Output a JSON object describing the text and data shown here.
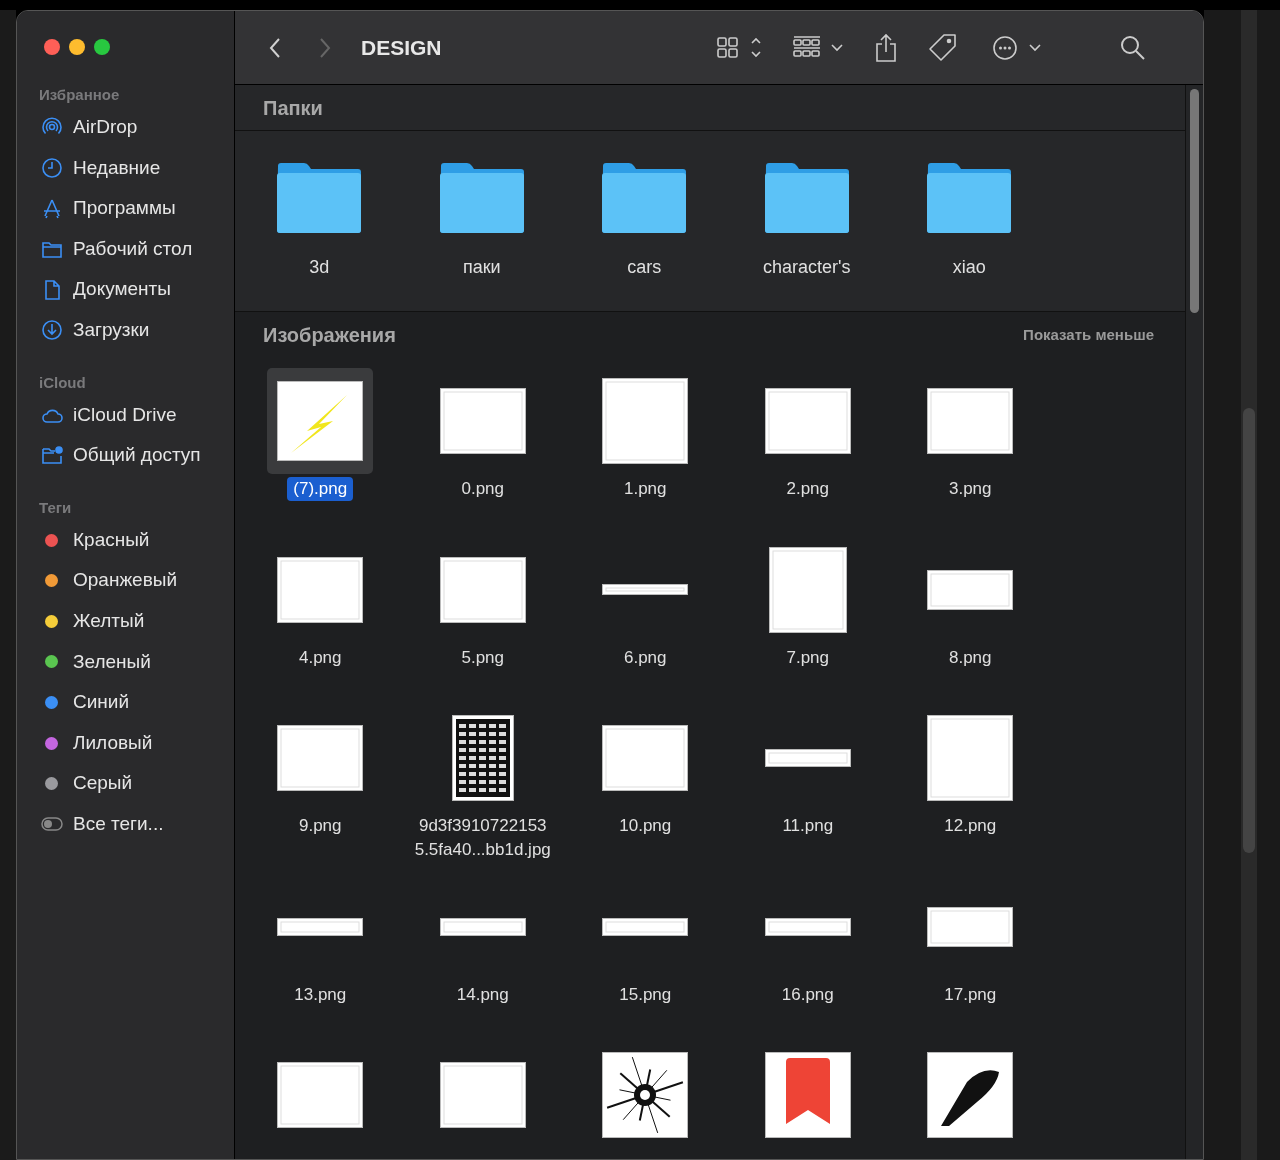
{
  "window": {
    "title": "DESIGN"
  },
  "sidebar": [
    {
      "heading": "Избранное",
      "items": [
        {
          "label": "AirDrop",
          "kind": "airdrop"
        },
        {
          "label": "Недавние",
          "kind": "clock"
        },
        {
          "label": "Программы",
          "kind": "apps"
        },
        {
          "label": "Рабочий стол",
          "kind": "folder"
        },
        {
          "label": "Документы",
          "kind": "doc"
        },
        {
          "label": "Загрузки",
          "kind": "download"
        }
      ]
    },
    {
      "heading": "iCloud",
      "items": [
        {
          "label": "iCloud Drive",
          "kind": "cloud"
        },
        {
          "label": "Общий доступ",
          "kind": "shared"
        }
      ]
    },
    {
      "heading": "Теги",
      "items": [
        {
          "label": "Красный",
          "kind": "tag",
          "color": "#ec5352"
        },
        {
          "label": "Оранжевый",
          "kind": "tag",
          "color": "#f19a37"
        },
        {
          "label": "Желтый",
          "kind": "tag",
          "color": "#f5cd3a"
        },
        {
          "label": "Зеленый",
          "kind": "tag",
          "color": "#5ac550"
        },
        {
          "label": "Синий",
          "kind": "tag",
          "color": "#3b8ff5"
        },
        {
          "label": "Лиловый",
          "kind": "tag",
          "color": "#c466e0"
        },
        {
          "label": "Серый",
          "kind": "tag",
          "color": "#9a9a9e"
        },
        {
          "label": "Все теги...",
          "kind": "alltags"
        }
      ]
    }
  ],
  "folders": {
    "title": "Папки",
    "items": [
      "3d",
      "паки",
      "cars",
      "character's",
      "xiao"
    ]
  },
  "images": {
    "title": "Изображения",
    "action": "Показать меньше",
    "items": [
      {
        "name": "(7).png",
        "kind": "lightning",
        "selected": true
      },
      {
        "name": "0.png",
        "kind": "landscape",
        "selected": false
      },
      {
        "name": "1.png",
        "kind": "square",
        "selected": false
      },
      {
        "name": "2.png",
        "kind": "landscape",
        "selected": false
      },
      {
        "name": "3.png",
        "kind": "landscape",
        "selected": false
      },
      {
        "name": "4.png",
        "kind": "landscape",
        "selected": false
      },
      {
        "name": "5.png",
        "kind": "landscape",
        "selected": false
      },
      {
        "name": "6.png",
        "kind": "strip",
        "selected": false
      },
      {
        "name": "7.png",
        "kind": "portrait",
        "selected": false
      },
      {
        "name": "8.png",
        "kind": "wide",
        "selected": false
      },
      {
        "name": "9.png",
        "kind": "landscape",
        "selected": false
      },
      {
        "name": "9d3f3910722153 5.5fa40...bb1d.jpg",
        "kind": "poster",
        "selected": false
      },
      {
        "name": "10.png",
        "kind": "landscape",
        "selected": false
      },
      {
        "name": "11.png",
        "kind": "band",
        "selected": false
      },
      {
        "name": "12.png",
        "kind": "square",
        "selected": false
      },
      {
        "name": "13.png",
        "kind": "band",
        "selected": false
      },
      {
        "name": "14.png",
        "kind": "band",
        "selected": false
      },
      {
        "name": "15.png",
        "kind": "band",
        "selected": false
      },
      {
        "name": "16.png",
        "kind": "band",
        "selected": false
      },
      {
        "name": "17.png",
        "kind": "wide",
        "selected": false
      },
      {
        "kind": "landscape",
        "selected": false
      },
      {
        "kind": "landscape",
        "selected": false
      },
      {
        "kind": "splash",
        "selected": false
      },
      {
        "kind": "bookmark",
        "selected": false
      },
      {
        "kind": "brush",
        "selected": false
      }
    ]
  }
}
